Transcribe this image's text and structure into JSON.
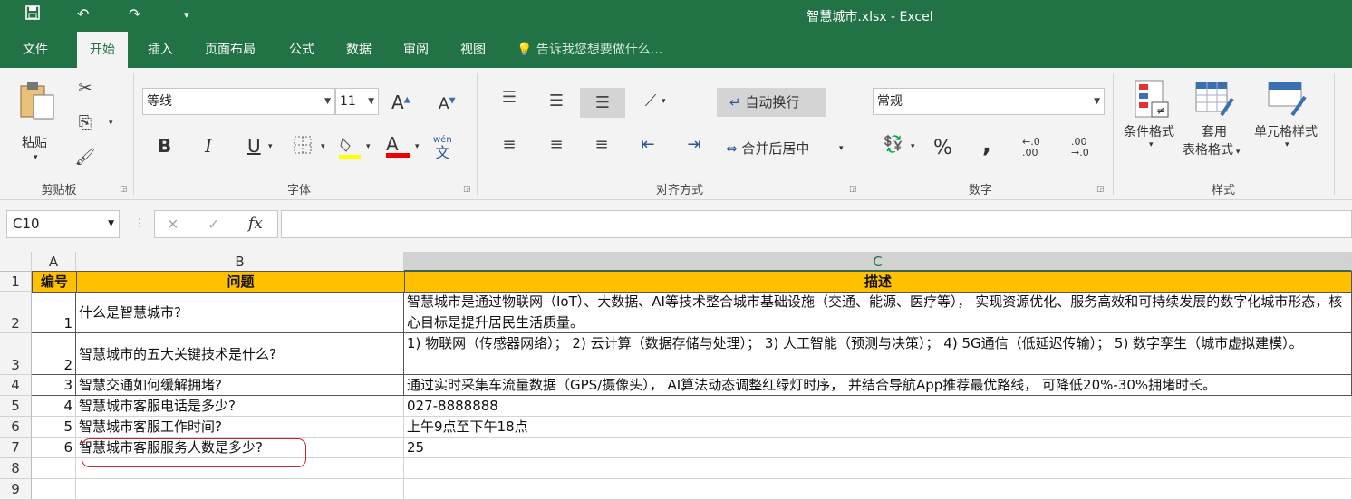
{
  "window": {
    "title": "智慧城市.xlsx - Excel"
  },
  "tabs": [
    "文件",
    "开始",
    "插入",
    "页面布局",
    "公式",
    "数据",
    "审阅",
    "视图"
  ],
  "tell_me": "告诉我您想要做什么...",
  "ribbon": {
    "clipboard": {
      "paste": "粘贴",
      "group": "剪贴板"
    },
    "font": {
      "name": "等线",
      "size": "11",
      "group": "字体",
      "bold": "B",
      "italic": "I",
      "underline": "U",
      "grow": "A",
      "shrink": "A",
      "color_letter": "A",
      "wen_top": "wén",
      "wen_bottom": "文"
    },
    "alignment": {
      "wrap": "自动换行",
      "merge": "合并后居中",
      "group": "对齐方式"
    },
    "number": {
      "format": "常规",
      "group": "数字",
      "percent": "%",
      "comma": ",",
      "inc_top": "←.0",
      "inc_bottom": ".00",
      "dec_top": ".00",
      "dec_bottom": "→.0"
    },
    "styles": {
      "conditional": "条件格式",
      "table_top": "套用",
      "table_bottom": "表格格式",
      "cell_styles": "单元格样式",
      "group": "样式"
    }
  },
  "formula_bar": {
    "name_box": "C10",
    "cancel": "✕",
    "enter": "✓",
    "fx": "fx",
    "content": ""
  },
  "columns": [
    "A",
    "B",
    "C"
  ],
  "rows": [
    "1",
    "2",
    "3",
    "4",
    "5",
    "6",
    "7",
    "8",
    "9"
  ],
  "header": {
    "a": "编号",
    "b": "问题",
    "c": "描述"
  },
  "data": [
    {
      "a": "1",
      "b": "什么是智慧城市?",
      "c": "智慧城市是通过物联网（IoT）、大数据、AI等技术整合城市基础设施（交通、能源、医疗等）， 实现资源优化、服务高效和可持续发展的数字化城市形态，核心目标是提升居民生活质量。"
    },
    {
      "a": "2",
      "b": "智慧城市的五大关键技术是什么?",
      "c": "1) 物联网（传感器网络）； 2) 云计算（数据存储与处理）； 3) 人工智能（预测与决策）； 4) 5G通信（低延迟传输）； 5) 数字孪生（城市虚拟建模）。"
    },
    {
      "a": "3",
      "b": "智慧交通如何缓解拥堵?",
      "c": "通过实时采集车流量数据（GPS/摄像头）， AI算法动态调整红绿灯时序， 并结合导航App推荐最优路线， 可降低20%-30%拥堵时长。"
    },
    {
      "a": "4",
      "b": "智慧城市客服电话是多少?",
      "c": "027-8888888"
    },
    {
      "a": "5",
      "b": "智慧城市客服工作时间?",
      "c": "上午9点至下午18点"
    },
    {
      "a": "6",
      "b": "智慧城市客服服务人数是多少?",
      "c": "25"
    }
  ],
  "colors": {
    "excel_green": "#217346",
    "header_fill": "#ffc000",
    "annotation": "#c62828"
  }
}
